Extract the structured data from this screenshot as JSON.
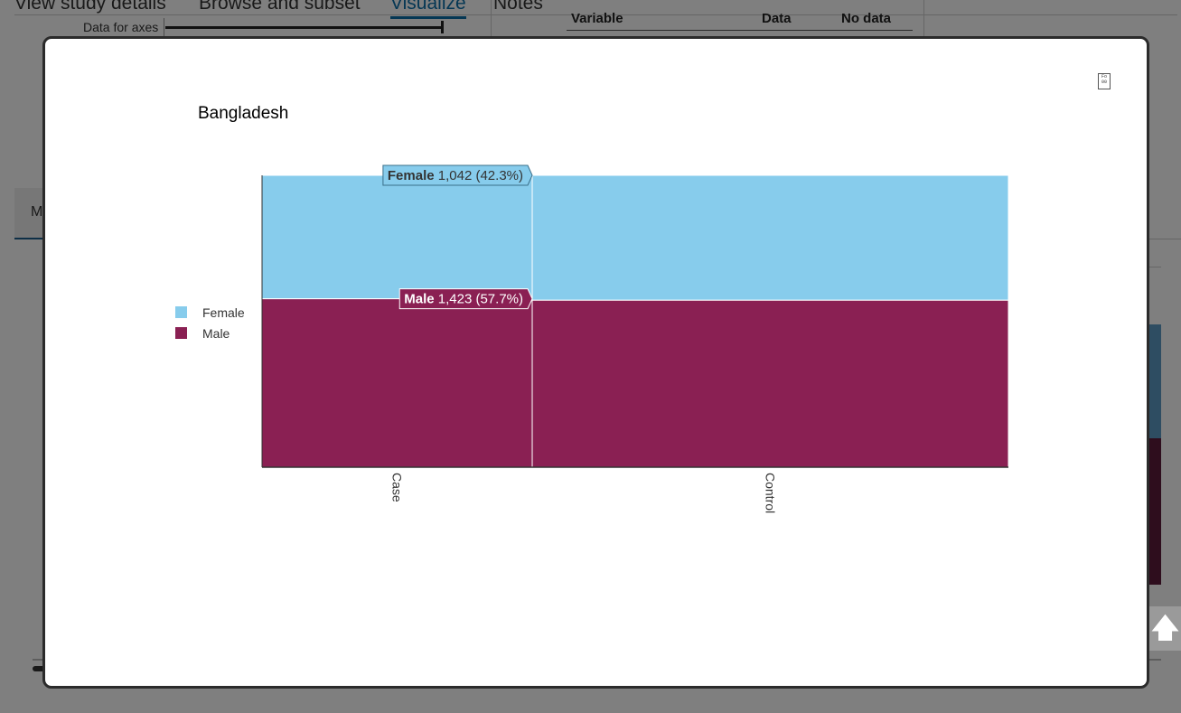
{
  "background_page": {
    "nav_tabs": [
      {
        "label": "View study details",
        "active": false
      },
      {
        "label": "Browse and subset",
        "active": false
      },
      {
        "label": "Visualize",
        "active": true
      },
      {
        "label": "Notes",
        "active": false
      }
    ],
    "axes_label": "Data for axes",
    "table_headers": [
      "Variable",
      "Data",
      "No data"
    ],
    "left_tab_label": "M"
  },
  "modal": {
    "title": "Bangladesh",
    "close_icon": "close-icon"
  },
  "colors": {
    "female": "#87CCEC",
    "male": "#8A2053"
  },
  "chart_data": {
    "type": "bar",
    "stacked": true,
    "normalized": true,
    "title": "Bangladesh",
    "categories": [
      "Case",
      "Control"
    ],
    "category_width_share": [
      0.362,
      0.638
    ],
    "series": [
      {
        "name": "Female",
        "values": [
          42.3,
          42.8
        ]
      },
      {
        "name": "Male",
        "values": [
          57.7,
          57.2
        ]
      }
    ],
    "tooltips": [
      {
        "series": "Female",
        "category": "Case",
        "label": "Female",
        "value": "1,042 (42.3%)"
      },
      {
        "series": "Male",
        "category": "Case",
        "label": "Male",
        "value": "1,423 (57.7%)"
      }
    ],
    "legend": [
      "Female",
      "Male"
    ],
    "legend_position": "left",
    "ylim": [
      0,
      100
    ],
    "grid": false
  }
}
